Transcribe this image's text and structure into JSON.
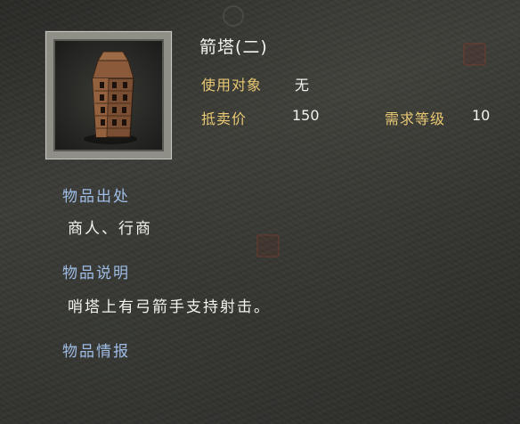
{
  "item": {
    "name": "箭塔(二)",
    "icon": "arrow-tower-icon"
  },
  "stats": {
    "use_target_label": "使用对象",
    "use_target_value": "无",
    "price_label": "抵卖价",
    "price_value": "150",
    "level_label": "需求等级",
    "level_value": "10"
  },
  "sections": {
    "source_heading": "物品出处",
    "source_text": "商人、行商",
    "description_heading": "物品说明",
    "description_text": "哨塔上有弓箭手支持射击。",
    "intel_heading": "物品情报"
  },
  "colors": {
    "label_gold": "#e8c873",
    "heading_blue": "#9fbde6",
    "text_white": "#f2f2ee"
  }
}
